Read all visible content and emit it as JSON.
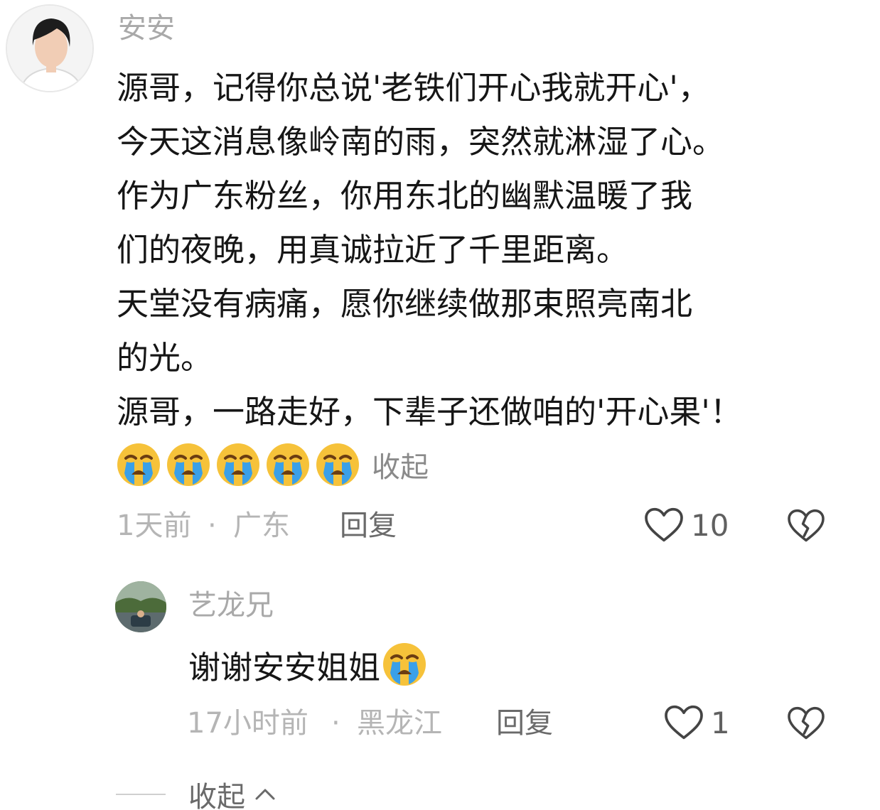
{
  "comment": {
    "author": "安安",
    "lines": [
      "源哥，记得你总说'老铁们开心我就开心'，",
      "今天这消息像岭南的雨，突然就淋湿了心。",
      "作为广东粉丝，你用东北的幽默温暖了我",
      "们的夜晚，用真诚拉近了千里距离。",
      "天堂没有病痛，愿你继续做那束照亮南北",
      "的光。",
      "源哥，一路走好，下辈子还做咱的'开心果'！"
    ],
    "emojis": [
      "crying-emoji",
      "crying-emoji",
      "crying-emoji",
      "crying-emoji",
      "crying-emoji"
    ],
    "collapse_label": "收起",
    "time": "1天前",
    "dot": "·",
    "location": "广东",
    "reply_label": "回复",
    "like_count": "10"
  },
  "reply": {
    "author": "艺龙兄",
    "text": "谢谢安安姐姐",
    "emoji": "crying-emoji",
    "time": "17小时前",
    "dot": "·",
    "location": "黑龙江",
    "reply_label": "回复",
    "like_count": "1"
  },
  "thread_collapse_label": "收起",
  "colors": {
    "text": "#161616",
    "muted": "#a9a9a9",
    "emoji_face": "#f6c23a",
    "emoji_tear": "#3aa0e8"
  }
}
